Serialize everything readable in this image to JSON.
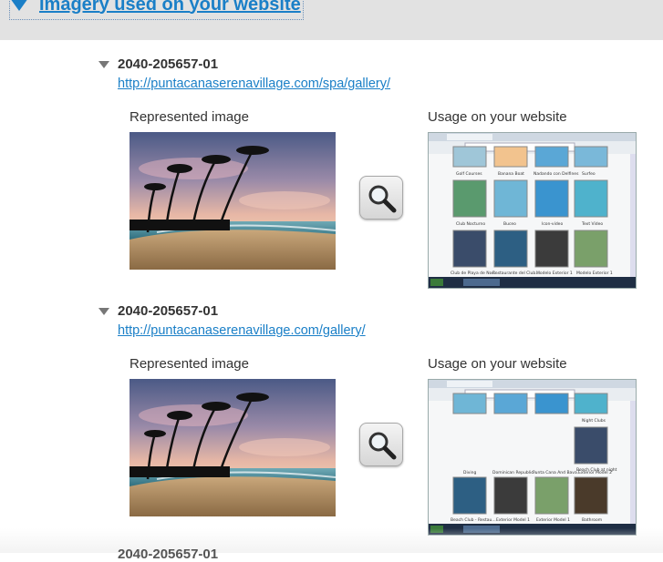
{
  "section": {
    "title": "Imagery used on your website",
    "toggle_icon": "triangle-down-icon",
    "accent_color": "#1a7fc7"
  },
  "column_labels": {
    "represented": "Represented image",
    "usage": "Usage on your website"
  },
  "entries": [
    {
      "id": "2040-205657-01",
      "url": "http://puntacanaserenavillage.com/spa/gallery/",
      "zoom_icon": "magnifier-icon",
      "thumbs": [
        {
          "caption": "Golf Courses"
        },
        {
          "caption": "Banana Boat"
        },
        {
          "caption": "Nadando con Delfines"
        },
        {
          "caption": "Surfeo"
        },
        {
          "caption": "Club Nocturno"
        },
        {
          "caption": "Buceo"
        },
        {
          "caption": "Icon-video"
        },
        {
          "caption": "Text Video"
        }
      ],
      "footer_captions": [
        "Club de Playa de Noc...",
        "Restaurante del Club...",
        "Modelo Exterior 1",
        "Modelo Exterior 1"
      ]
    },
    {
      "id": "2040-205657-01",
      "url": "http://puntacanaserenavillage.com/gallery/",
      "zoom_icon": "magnifier-icon",
      "thumbs": [
        {
          "caption": "Night Clubs"
        },
        {
          "caption": "Beach Club at night"
        },
        {
          "caption": "Diving"
        },
        {
          "caption": "Dominican Republic..."
        },
        {
          "caption": "Punta Cana And Bava..."
        },
        {
          "caption": "Exterior Model 2"
        }
      ],
      "footer_captions": [
        "Beach Club - Restau...",
        "Exterior Model 1",
        "Exterior Model 1",
        "Bathroom"
      ]
    }
  ],
  "next_entry_id": "2040-205657-01"
}
